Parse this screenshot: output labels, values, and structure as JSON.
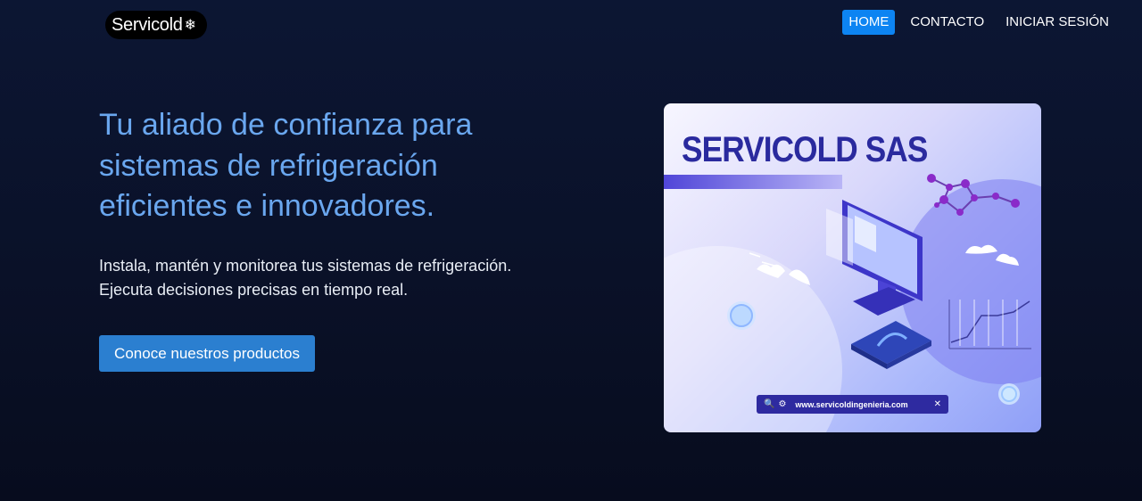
{
  "header": {
    "logo_text": "Servicold",
    "logo_icon": "snowflake-icon",
    "nav": [
      {
        "label": "HOME",
        "active": true
      },
      {
        "label": "CONTACTO",
        "active": false
      },
      {
        "label": "INICIAR SESIÓN",
        "active": false
      }
    ]
  },
  "hero": {
    "title": "Tu aliado de confianza para sistemas de refrigeración eficientes e innovadores.",
    "subtitle_line1": "Instala, mantén y monitorea tus sistemas de refrigeración.",
    "subtitle_line2": "Ejecuta decisiones precisas en tiempo real.",
    "cta_label": "Conoce nuestros productos"
  },
  "hero_image": {
    "title": "SERVICOLD SAS",
    "url": "www.servicoldingenieria.com",
    "close_glyph": "✕"
  },
  "colors": {
    "accent": "#0d84f2",
    "title": "#6aa7ef",
    "button": "#2b7fd0",
    "background": "#0a1128"
  }
}
